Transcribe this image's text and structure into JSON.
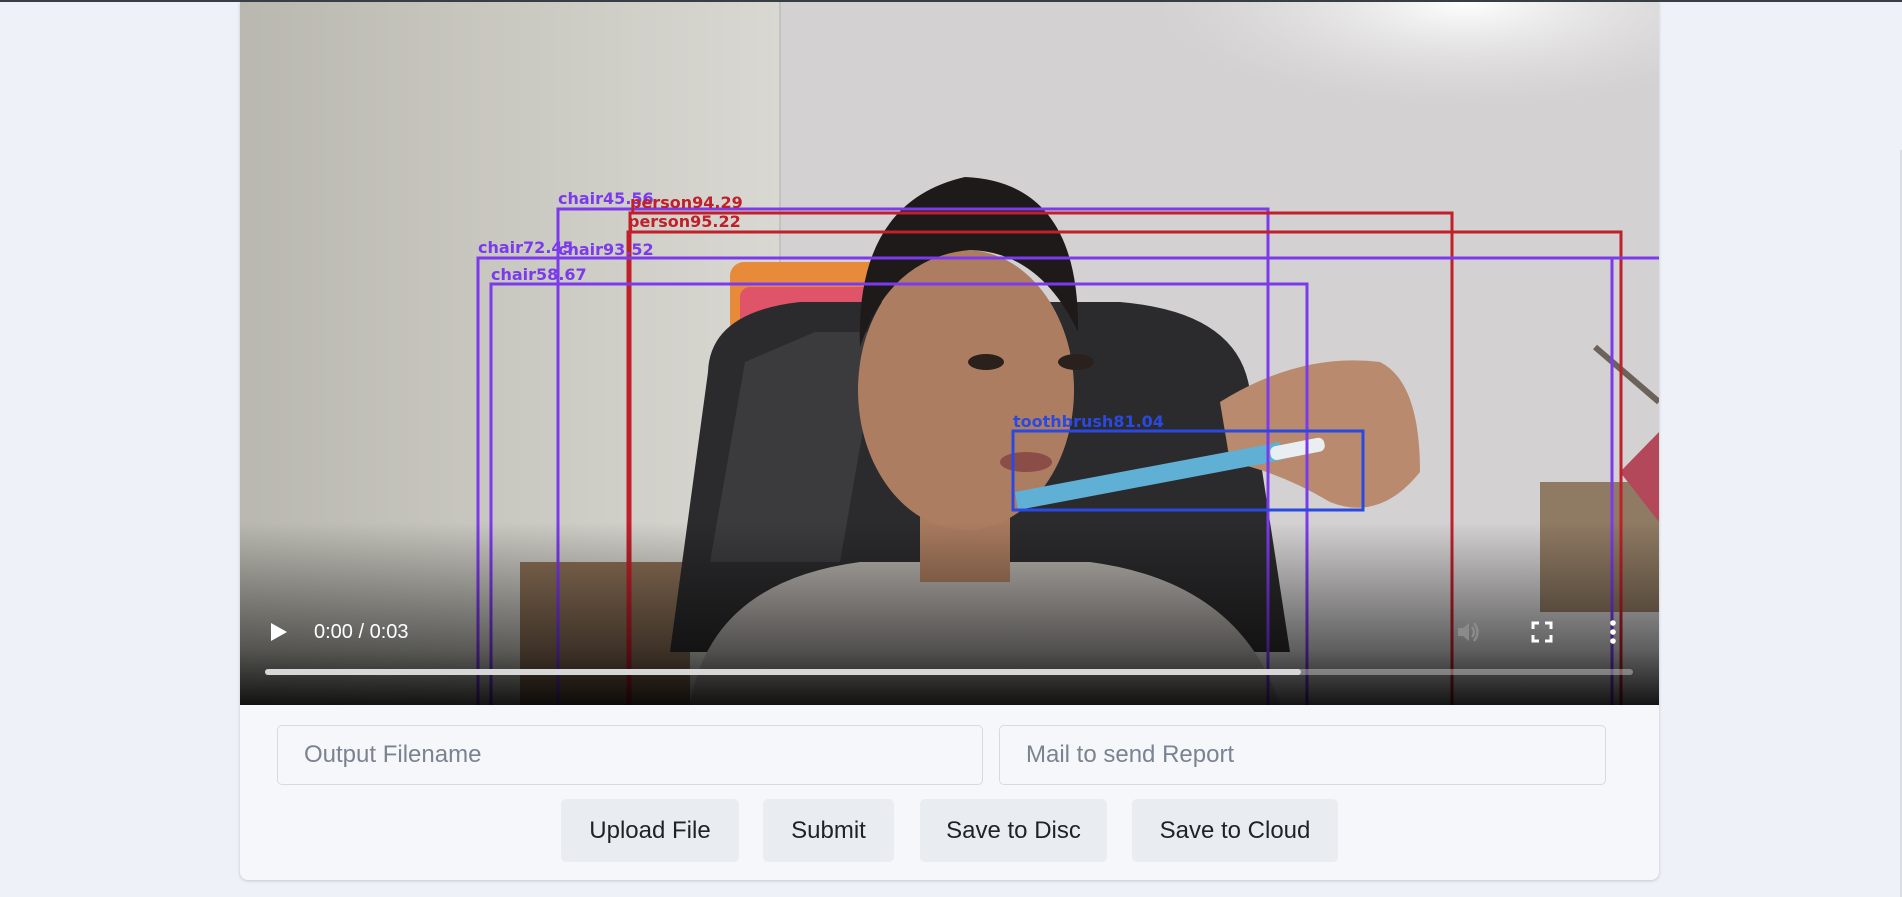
{
  "video": {
    "time_display": "0:00 / 0:03",
    "progress_fraction": 0.757,
    "detections": [
      {
        "label": "chair45.56",
        "color": "#7c3aed"
      },
      {
        "label": "person94.29",
        "color": "#c0202a"
      },
      {
        "label": "person95.22",
        "color": "#c0202a"
      },
      {
        "label": "chair72.45",
        "color": "#7c3aed"
      },
      {
        "label": "chair93.52",
        "color": "#7c3aed"
      },
      {
        "label": "chair58.67",
        "color": "#7c3aed"
      },
      {
        "label": "toothbrush81.04",
        "color": "#2a49e0"
      }
    ]
  },
  "form": {
    "filename_placeholder": "Output Filename",
    "mail_placeholder": "Mail to send Report"
  },
  "buttons": {
    "upload": "Upload File",
    "submit": "Submit",
    "save_disc": "Save to Disc",
    "save_cloud": "Save to Cloud"
  }
}
